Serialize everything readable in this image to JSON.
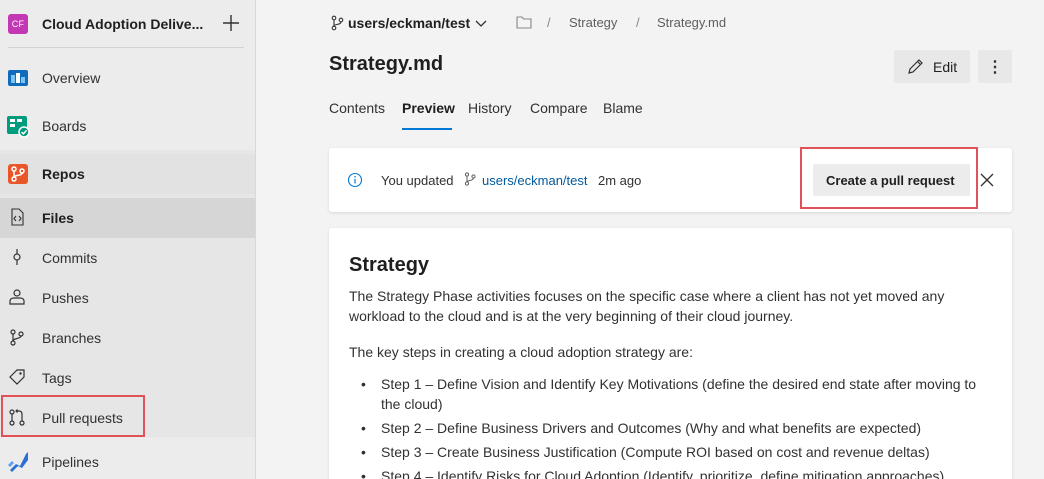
{
  "project": {
    "badge": "CF",
    "name": "Cloud Adoption Delive..."
  },
  "sidebar": {
    "items": [
      {
        "label": "Overview"
      },
      {
        "label": "Boards"
      },
      {
        "label": "Repos"
      },
      {
        "label": "Files"
      },
      {
        "label": "Commits"
      },
      {
        "label": "Pushes"
      },
      {
        "label": "Branches"
      },
      {
        "label": "Tags"
      },
      {
        "label": "Pull requests"
      },
      {
        "label": "Pipelines"
      }
    ]
  },
  "breadcrumb": {
    "branch": "users/eckman/test",
    "sep": "/",
    "folder": "Strategy",
    "file": "Strategy.md"
  },
  "header": {
    "title": "Strategy.md",
    "edit_label": "Edit",
    "more_label": "⋮"
  },
  "tabs": [
    {
      "label": "Contents"
    },
    {
      "label": "Preview"
    },
    {
      "label": "History"
    },
    {
      "label": "Compare"
    },
    {
      "label": "Blame"
    }
  ],
  "notice": {
    "prefix": "You updated",
    "branch": "users/eckman/test",
    "suffix": "2m ago",
    "button": "Create a pull request"
  },
  "document": {
    "heading": "Strategy",
    "para1": "The Strategy Phase activities focuses on the specific case where a client has not yet moved any workload to the cloud and is at the very beginning of their cloud journey.",
    "para2": "The key steps in creating a cloud adoption strategy are:",
    "steps": [
      "Step 1 – Define Vision and Identify Key Motivations (define the desired end state after moving to the cloud)",
      "Step 2 – Define Business Drivers and Outcomes (Why and what benefits are expected)",
      "Step 3 – Create Business Justification (Compute ROI based on cost and revenue deltas)",
      "Step 4 – Identify Risks for Cloud Adoption (Identify, prioritize, define mitigation approaches)"
    ]
  },
  "colors": {
    "accent": "#0078d4",
    "highlight": "#e05257",
    "badge": "#c239b3"
  }
}
